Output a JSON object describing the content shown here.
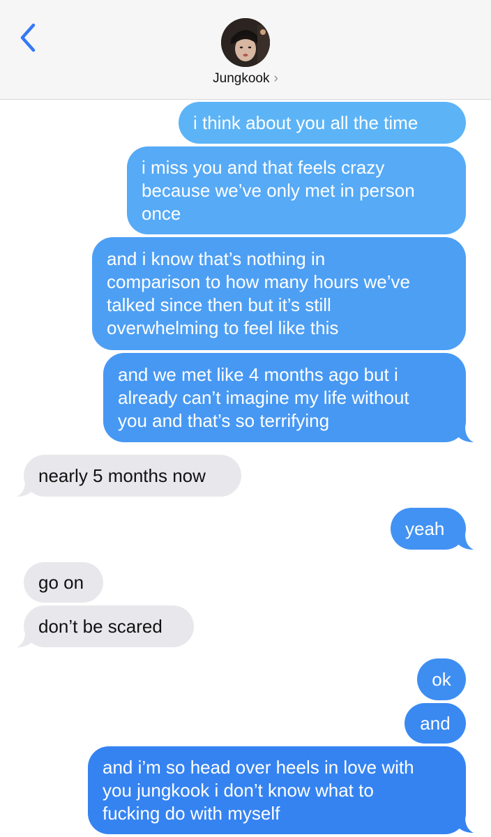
{
  "header": {
    "contact_name": "Jungkook",
    "chevron": "›",
    "back_icon": "chevron-left-icon",
    "accent_color": "#3478f6"
  },
  "messages": [
    {
      "side": "sent",
      "text": "i think about you all the time"
    },
    {
      "side": "sent",
      "text": "i miss you and that feels crazy\nbecause we’ve only met in person\nonce"
    },
    {
      "side": "sent",
      "text": "and i know that’s nothing in\ncomparison to how many hours we’ve\ntalked since then but it’s still\noverwhelming to feel like this"
    },
    {
      "side": "sent",
      "text": "and we met like 4 months ago but i\nalready can’t imagine my life without\nyou and that’s so terrifying"
    },
    {
      "side": "received",
      "text": "nearly 5 months now"
    },
    {
      "side": "sent",
      "text": "yeah"
    },
    {
      "side": "received",
      "text": "go on"
    },
    {
      "side": "received",
      "text": "don’t be scared"
    },
    {
      "side": "sent",
      "text": "ok"
    },
    {
      "side": "sent",
      "text": "and"
    },
    {
      "side": "sent",
      "text": "and i’m so head over heels in love with\nyou jungkook i don’t know what to\nfucking do with myself"
    }
  ],
  "colors": {
    "sent_bubble": "#3d8ff5",
    "received_bubble": "#e8e8ec",
    "header_bg": "#f6f6f6"
  }
}
